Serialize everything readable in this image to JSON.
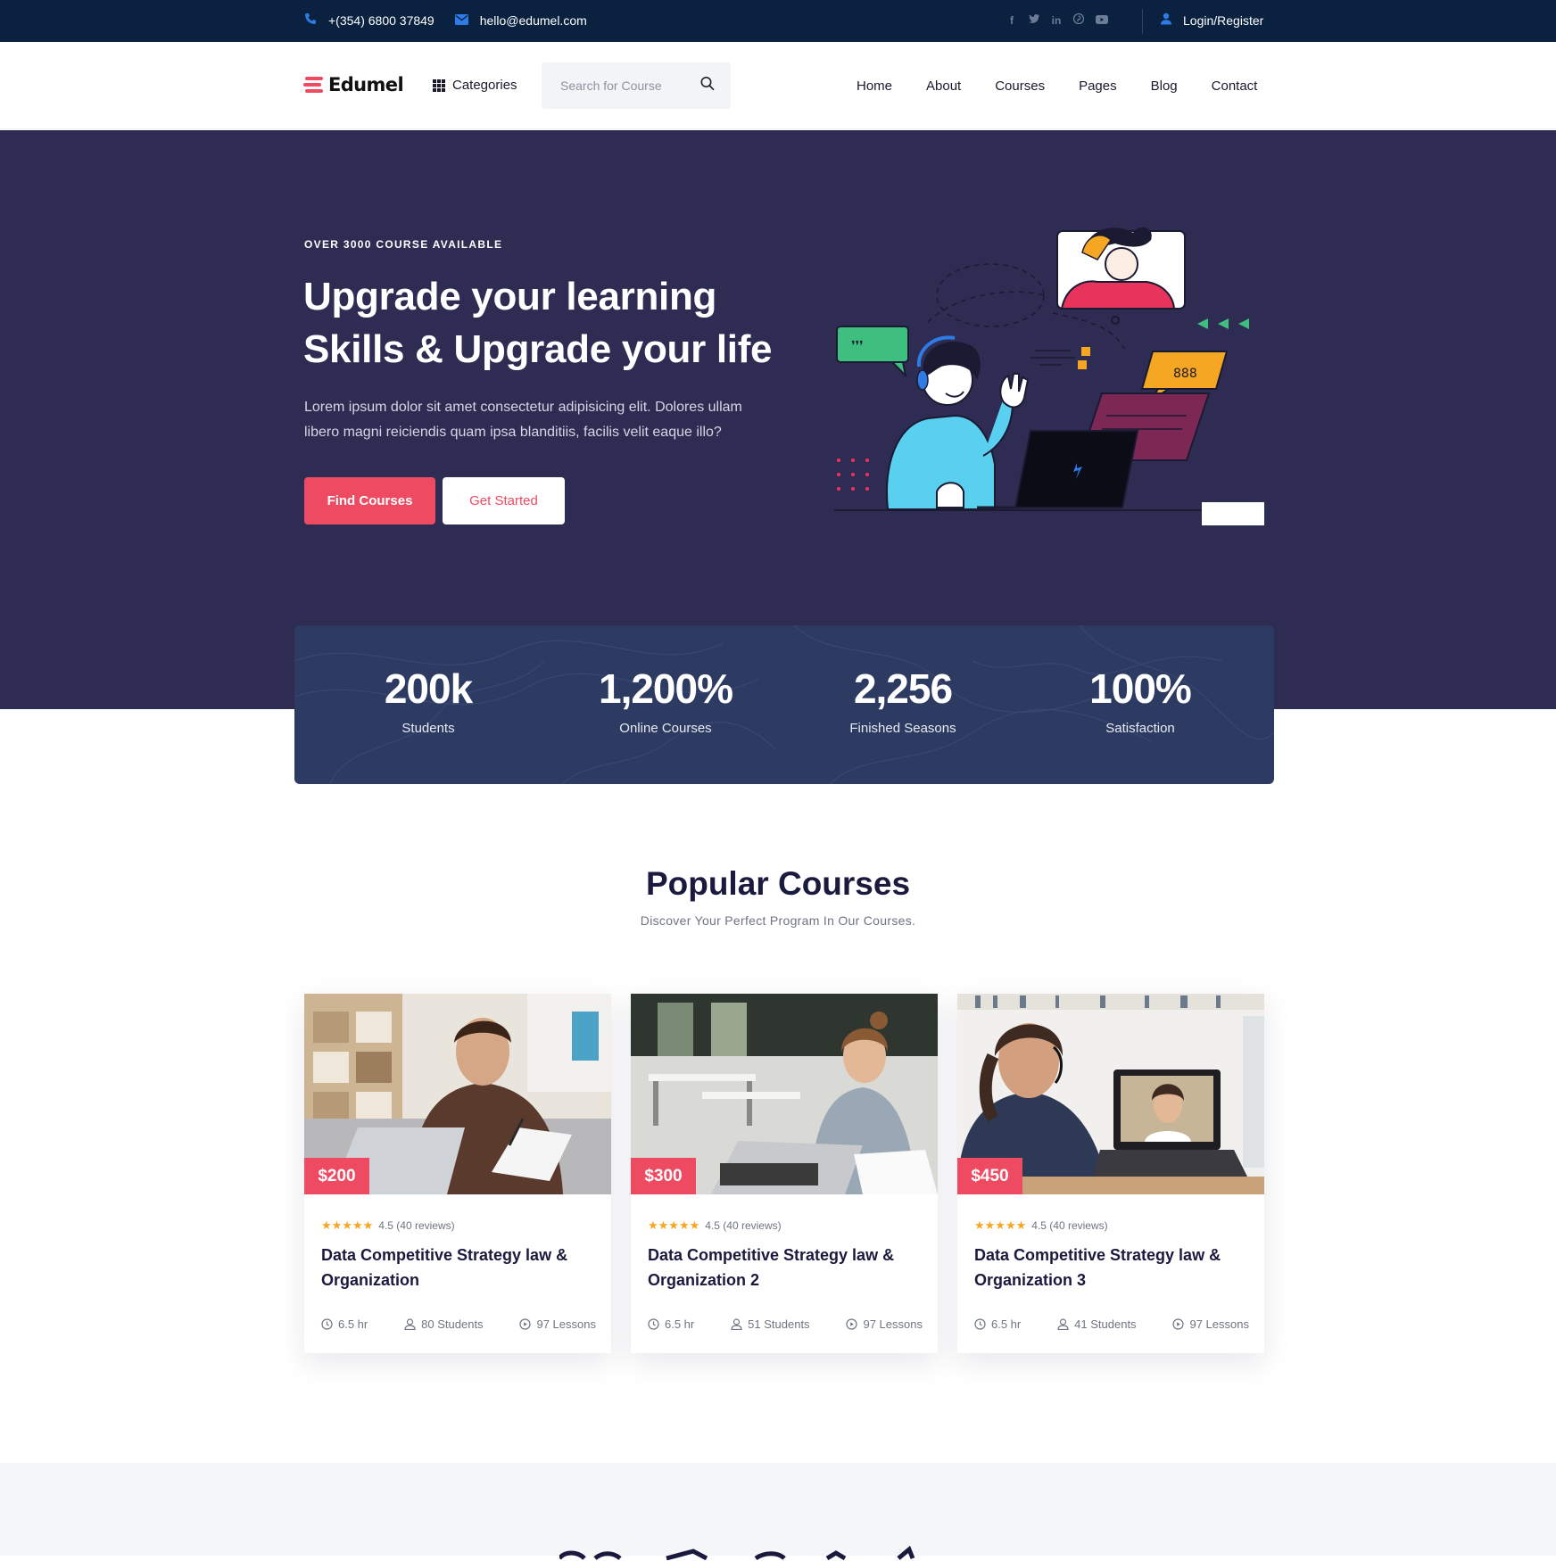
{
  "topbar": {
    "phone": "+(354) 6800 37849",
    "email": "hello@edumel.com",
    "social": [
      "facebook-icon",
      "twitter-icon",
      "linkedin-icon",
      "pinterest-icon",
      "youtube-icon"
    ],
    "login": "Login/Register"
  },
  "nav": {
    "logo": "Edumel",
    "categories": "Categories",
    "search_placeholder": "Search for Course",
    "menu": [
      "Home",
      "About",
      "Courses",
      "Pages",
      "Blog",
      "Contact"
    ]
  },
  "hero": {
    "eyebrow": "OVER 3000 COURSE AVAILABLE",
    "title": "Upgrade your learning Skills & Upgrade your life",
    "text": "Lorem ipsum dolor sit amet consectetur adipisicing elit. Dolores ullam libero magni reiciendis quam ipsa blanditiis, facilis velit eaque illo?",
    "btn_primary": "Find Courses",
    "btn_secondary": "Get Started"
  },
  "stats": [
    {
      "value": "200k",
      "label": "Students"
    },
    {
      "value": "1,200%",
      "label": "Online Courses"
    },
    {
      "value": "2,256",
      "label": "Finished Seasons"
    },
    {
      "value": "100%",
      "label": "Satisfaction"
    }
  ],
  "popular": {
    "title": "Popular Courses",
    "subtitle": "Discover Your Perfect Program In Our Courses.",
    "courses": [
      {
        "price": "$200",
        "stars": "★★★★★",
        "rating": "4.5 (40 reviews)",
        "title": "Data Competitive Strategy law & Organization",
        "hours": "6.5 hr",
        "students": "80 Students",
        "lessons": "97 Lessons"
      },
      {
        "price": "$300",
        "stars": "★★★★★",
        "rating": "4.5 (40 reviews)",
        "title": "Data Competitive Strategy law & Organization 2",
        "hours": "6.5 hr",
        "students": "51 Students",
        "lessons": "97 Lessons"
      },
      {
        "price": "$450",
        "stars": "★★★★★",
        "rating": "4.5 (40 reviews)",
        "title": "Data Competitive Strategy law & Organization 3",
        "hours": "6.5 hr",
        "students": "41 Students",
        "lessons": "97 Lessons"
      }
    ]
  },
  "colors": {
    "topbar": "#0a2240",
    "hero": "#2e2c52",
    "stats": "#2d3b63",
    "accent": "#ee4a62",
    "link_blue": "#2f7be5"
  }
}
